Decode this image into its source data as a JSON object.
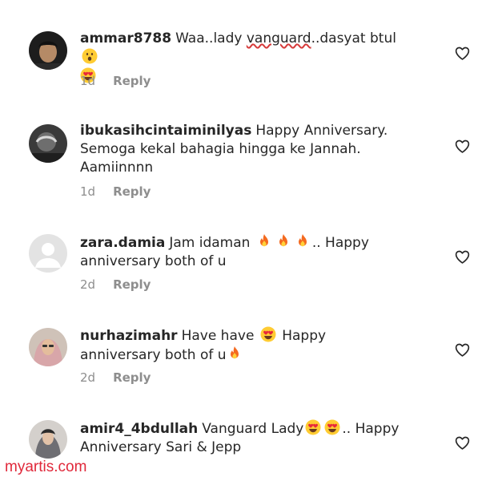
{
  "comments": [
    {
      "username": "ammar8788",
      "text_parts": [
        "Waa..lady ",
        "vanguard",
        "..dasyat btul"
      ],
      "time": "1d",
      "reply_label": "Reply"
    },
    {
      "username": "ibukasihcintaiminilyas",
      "text": "Happy Anniversary. Semoga kekal bahagia hingga ke Jannah. Aamiinnnn",
      "time": "1d",
      "reply_label": "Reply"
    },
    {
      "username": "zara.damia",
      "text_a": "Jam idaman",
      "text_b": ".. Happy anniversary both of u",
      "time": "2d",
      "reply_label": "Reply"
    },
    {
      "username": "nurhazimahr",
      "text_a": "Have have",
      "text_b": "Happy anniversary both of u",
      "time": "2d",
      "reply_label": "Reply"
    },
    {
      "username": "amir4_4bdullah",
      "text_a": "Vanguard Lady",
      "text_b": ".. Happy Anniversary Sari & Jepp"
    }
  ],
  "icons": {
    "like": "heart-outline-icon",
    "emoji_surprised": "face-open-mouth-emoji",
    "emoji_heart_eyes": "smiling-face-heart-eyes-emoji",
    "emoji_fire": "fire-emoji"
  },
  "watermark": "myartis.com"
}
